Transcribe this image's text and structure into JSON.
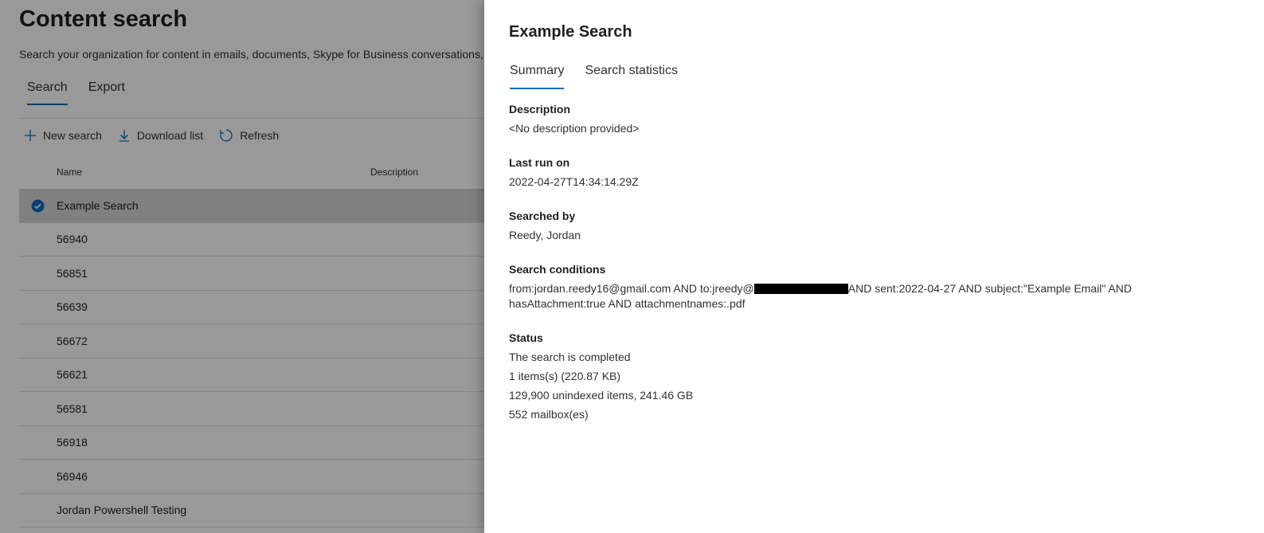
{
  "page": {
    "title": "Content search",
    "description": "Search your organization for content in emails, documents, Skype for Business conversations, and more",
    "tabs": [
      {
        "label": "Search",
        "active": true
      },
      {
        "label": "Export",
        "active": false
      }
    ],
    "toolbar": {
      "new_search": "New search",
      "download_list": "Download list",
      "refresh": "Refresh"
    },
    "columns": {
      "name": "Name",
      "description": "Description"
    },
    "rows": [
      {
        "name": "Example Search",
        "selected": true
      },
      {
        "name": "56940"
      },
      {
        "name": "56851"
      },
      {
        "name": "56639"
      },
      {
        "name": "56672"
      },
      {
        "name": "56621"
      },
      {
        "name": "56581"
      },
      {
        "name": "56918"
      },
      {
        "name": "56946"
      },
      {
        "name": "Jordan Powershell Testing"
      }
    ]
  },
  "panel": {
    "title": "Example Search",
    "tabs": [
      {
        "label": "Summary",
        "active": true
      },
      {
        "label": "Search statistics",
        "active": false
      }
    ],
    "description_label": "Description",
    "description_value": "<No description provided>",
    "last_run_label": "Last run on",
    "last_run_value": "2022-04-27T14:34:14.29Z",
    "searched_by_label": "Searched by",
    "searched_by_value": "Reedy, Jordan",
    "conditions_label": "Search conditions",
    "conditions_part1": "from:jordan.reedy16@gmail.com AND to:jreedy@",
    "conditions_part2": "AND sent:2022-04-27 AND subject:\"Example Email\" AND hasAttachment:true AND attachmentnames:.pdf",
    "status_label": "Status",
    "status_lines": [
      "The search is completed",
      "1 items(s) (220.87 KB)",
      "129,900 unindexed items, 241.46 GB",
      "552 mailbox(es)"
    ]
  },
  "colors": {
    "accent": "#0f6cbd",
    "overlay": "rgba(0,0,0,0.4)"
  }
}
